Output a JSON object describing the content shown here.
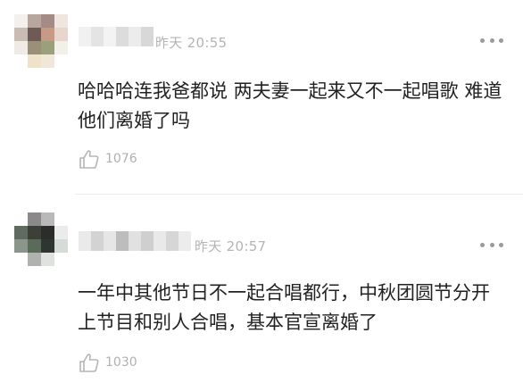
{
  "comments": [
    {
      "time": "昨天 20:55",
      "text": "哈哈哈连我爸都说 两夫妻一起来又不一起唱歌 难道他们离婚了吗",
      "likes": "1076",
      "like_icon": "thumbs-up-icon",
      "more_icon": "more-dots-icon"
    },
    {
      "time": "昨天 20:57",
      "text": "一年中其他节日不一起合唱都行，中秋团圆节分开上节目和别人合唱，基本官宣离婚了",
      "likes": "1030",
      "like_icon": "thumbs-up-icon",
      "more_icon": "more-dots-icon"
    }
  ]
}
